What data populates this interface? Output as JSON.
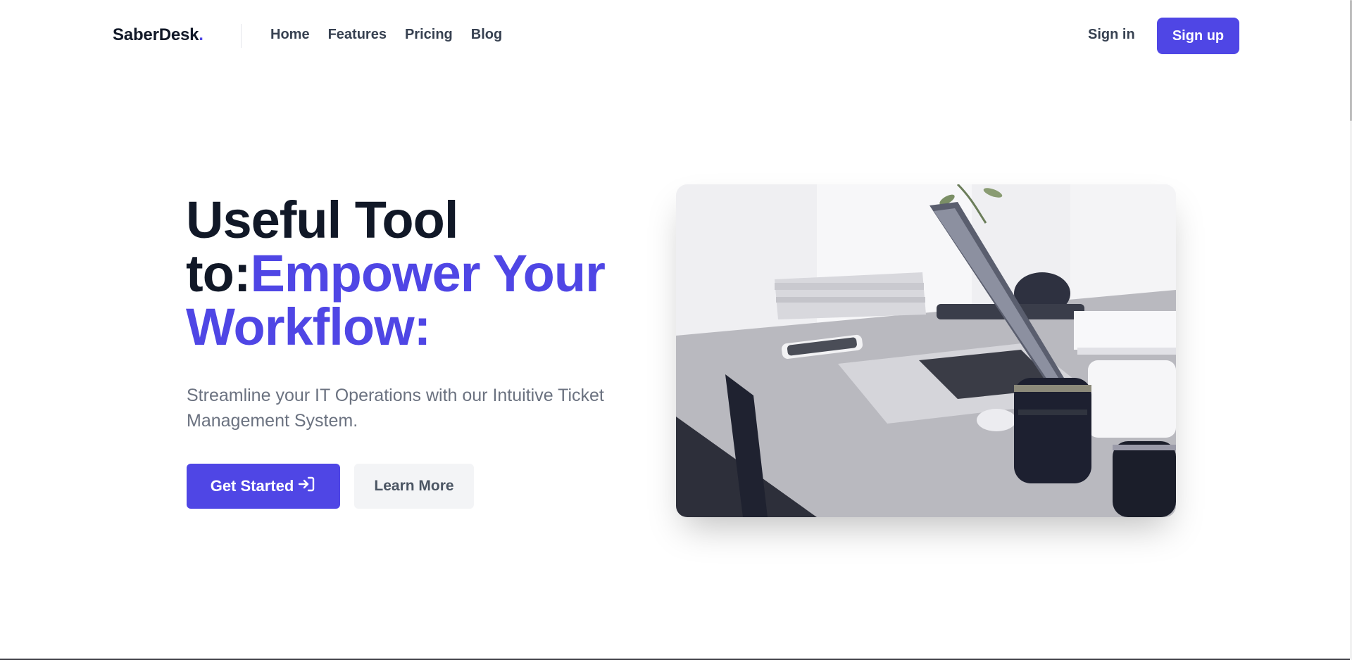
{
  "header": {
    "logo_text": "SaberDesk",
    "logo_dot": ".",
    "nav": [
      {
        "label": "Home"
      },
      {
        "label": "Features"
      },
      {
        "label": "Pricing"
      },
      {
        "label": "Blog"
      }
    ],
    "signin_label": "Sign in",
    "signup_label": "Sign up"
  },
  "hero": {
    "headline_part1": "Useful Tool to:",
    "headline_accent": "Empower Your Workflow:",
    "subtext": "Streamline your IT Operations with our Intuitive Ticket Management System.",
    "primary_cta": "Get Started",
    "primary_cta_icon": "sign-in-arrow-icon",
    "secondary_cta": "Learn More",
    "image_alt": "laptop-desk-photo"
  },
  "colors": {
    "accent": "#4f46e5",
    "heading": "#111827",
    "body_text": "#6b7280",
    "secondary_button_bg": "#f3f4f6"
  }
}
